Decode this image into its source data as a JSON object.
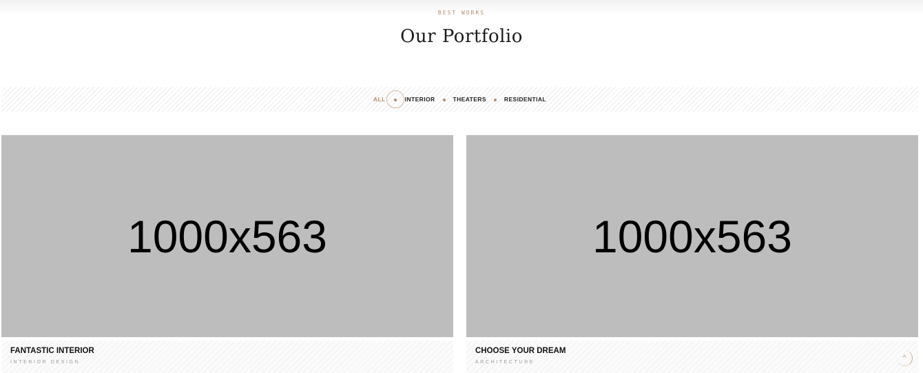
{
  "section": {
    "subtitle": "BEST WORKS",
    "title": "Our Portfolio"
  },
  "filters": [
    {
      "label": "ALL",
      "active": true
    },
    {
      "label": "INTERIOR",
      "active": false
    },
    {
      "label": "THEATERS",
      "active": false
    },
    {
      "label": "RESIDENTIAL",
      "active": false
    }
  ],
  "portfolio": [
    {
      "image_placeholder": "1000x563",
      "title": "FANTASTIC INTERIOR",
      "category": "INTERIOR DESIGN"
    },
    {
      "image_placeholder": "1000x563",
      "title": "CHOOSE YOUR DREAM",
      "category": "ARCHITECTURE"
    }
  ],
  "scroll_top": {
    "icon": "chevron-up-icon",
    "glyph": "^"
  },
  "colors": {
    "accent": "#b3906f",
    "placeholder_bg": "#bdbdbd",
    "text": "#1c1c1c"
  }
}
